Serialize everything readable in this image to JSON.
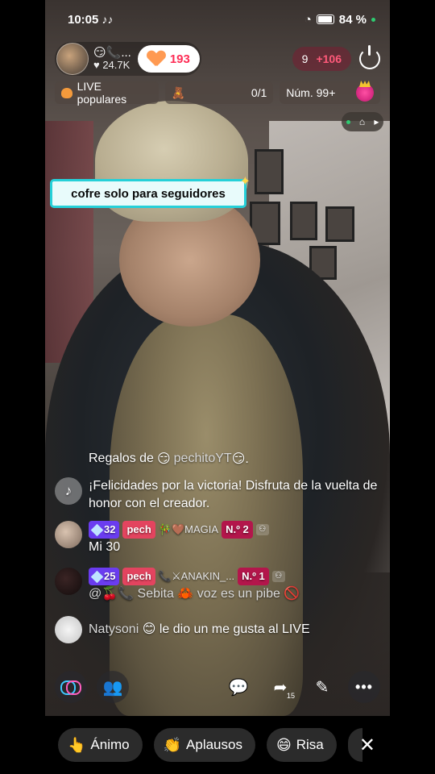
{
  "status_bar": {
    "time": "10:05",
    "battery": "84 %",
    "app_icons": [
      "tiktok-icon",
      "tiktok-icon"
    ]
  },
  "host": {
    "name": "😏📞...",
    "likes": "♥ 24.7K",
    "hearts": "193"
  },
  "viewers": {
    "count": "9",
    "delta": "+106"
  },
  "chips": {
    "live_popular": "LIVE populares",
    "fan_progress": "0/1",
    "rank": "Núm. 99+"
  },
  "banner": {
    "text": "cofre solo para seguidores"
  },
  "comments": {
    "gift": {
      "prefix": "Regalos de",
      "emoji_left": "😏",
      "user": "pechitoYT",
      "emoji_right": "😏."
    },
    "system_message": "¡Felicidades por la victoria! Disfruta de la vuelta de honor con el creador.",
    "items": [
      {
        "level": "32",
        "fan_badge": "pech",
        "name": "🎋🤎MAGIA",
        "number_badge": "N.º 2",
        "text": "Mi 30"
      },
      {
        "level": "25",
        "fan_badge": "pech",
        "name": "📞⚔ANAKIN_...",
        "number_badge": "N.º 1",
        "text": "@🍒📞 Sebita 🦀 voz es un pibe 🚫"
      }
    ],
    "like_message": {
      "user": "Natysoni",
      "emoji": "😊",
      "text": "le dio un me gusta al LIVE"
    }
  },
  "actions": {
    "share_count": "15"
  },
  "reactions": [
    {
      "icon": "👆",
      "label": "Ánimo"
    },
    {
      "icon": "👏",
      "label": "Aplausos"
    },
    {
      "icon": "😄",
      "label": "Risa"
    }
  ],
  "colors": {
    "accent": "#fe2c55",
    "banner_border": "#25d0d8",
    "level_badge": "#6a3cf0",
    "fan_badge": "#e3445f"
  }
}
